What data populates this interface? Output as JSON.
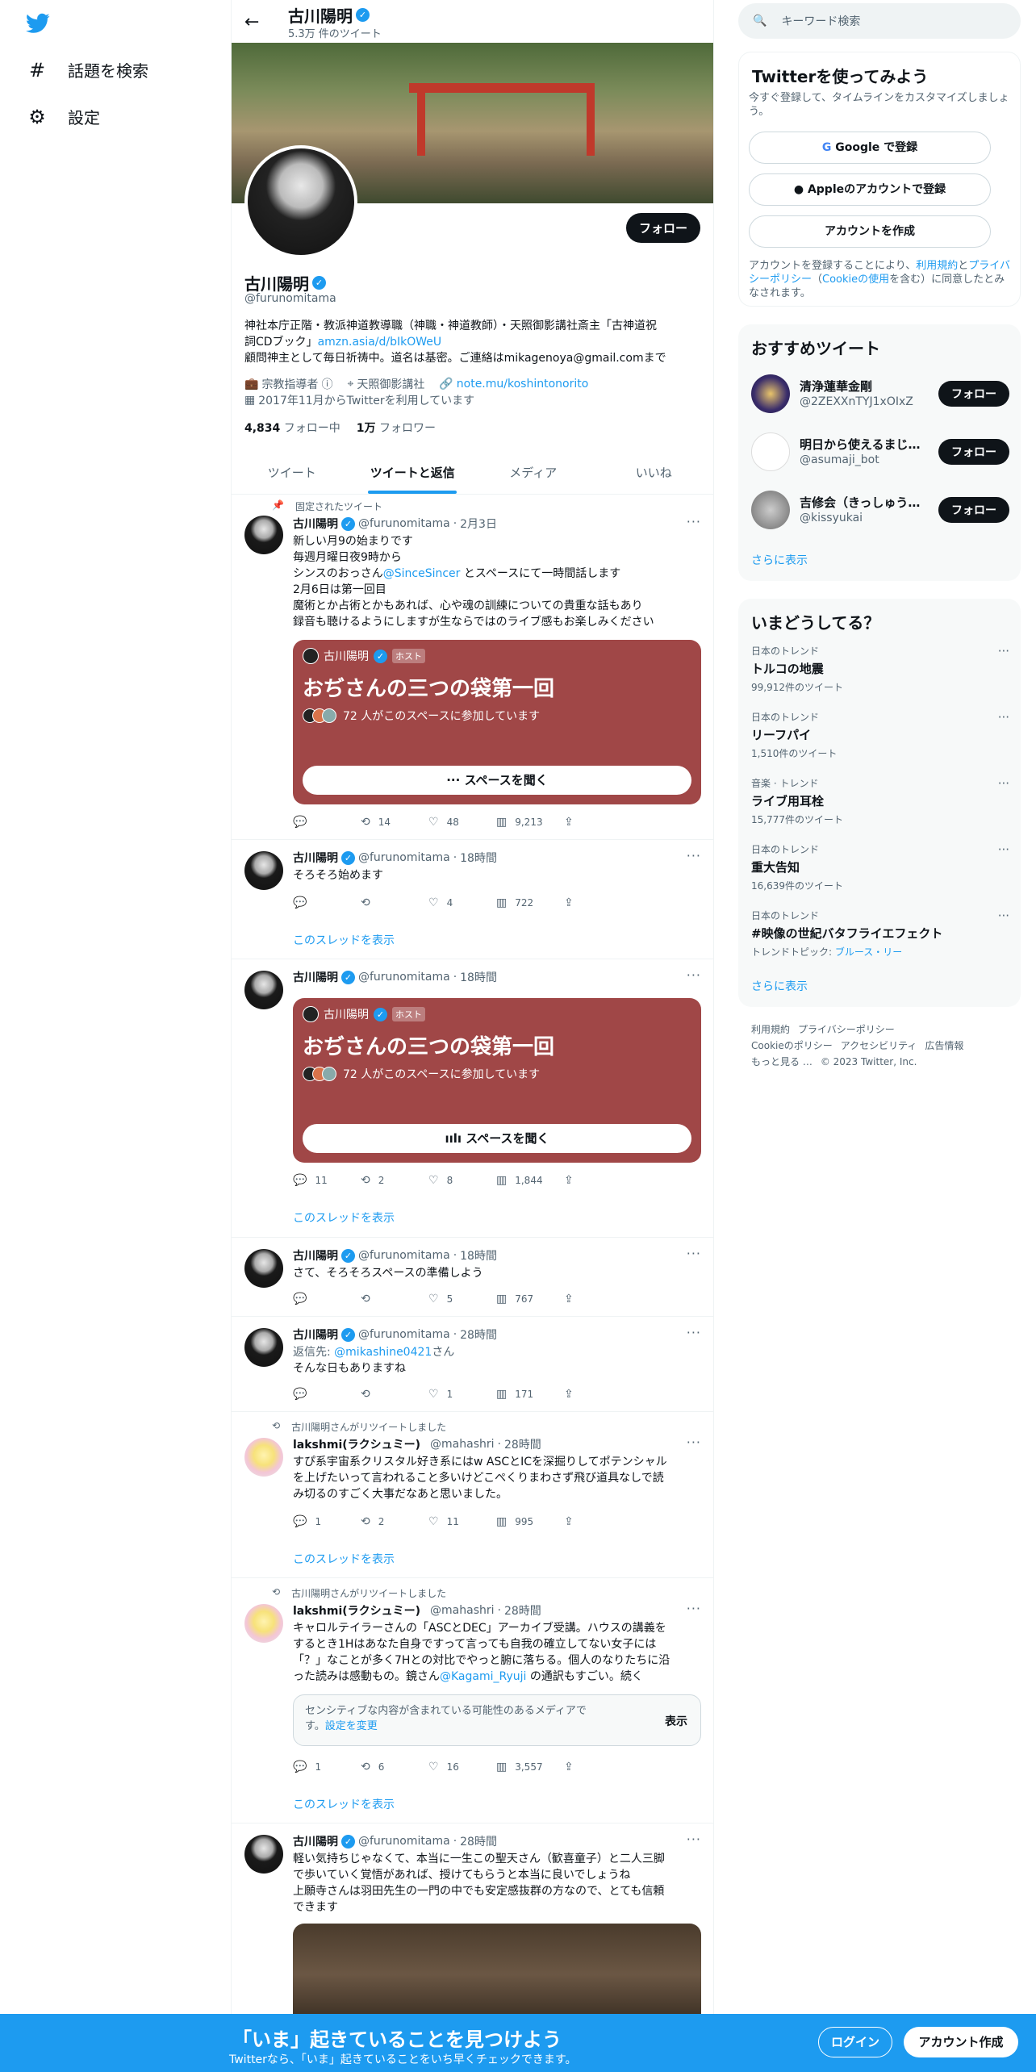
{
  "nav": {
    "explore": "話題を検索",
    "settings": "設定"
  },
  "header": {
    "name": "古川陽明",
    "count": "5.3万 件のツイート"
  },
  "profile": {
    "follow": "フォロー",
    "name": "古川陽明",
    "handle": "@furunomitama",
    "bio1": "神社本庁正階・教派神道教導職（神職・神道教師）・天照御影講社斎主「古神道祝",
    "bio2a": "詞CDブック」",
    "bio2link": "amzn.asia/d/bIkOWeU",
    "bio3": "顧問神主として毎日祈祷中。道名は基密。ご連絡はmikagenoya@gmail.comまで",
    "category": "宗教指導者",
    "location": "天照御影講社",
    "url": "note.mu/koshintonorito",
    "joined": "2017年11月からTwitterを利用しています",
    "following_n": "4,834",
    "following_l": "フォロー中",
    "followers_n": "1万",
    "followers_l": "フォロワー"
  },
  "tabs": [
    "ツイート",
    "ツイートと返信",
    "メディア",
    "いいね"
  ],
  "tweets": {
    "pinned": "固定されたツイート",
    "t1": {
      "name": "古川陽明",
      "handle": "@furunomitama",
      "time": "2月3日",
      "l1": "新しい月9の始まりです",
      "l2": "毎週月曜日夜9時から",
      "l3a": "シンスのおっさん",
      "l3b": "@SinceSincer",
      "l3c": " とスペースにて一時間話します",
      "l4": "2月6日は第一回目",
      "l5": "魔術とか占術とかもあれば、心や魂の訓練についての貴重な話もあり",
      "l6": "録音も聴けるようにしますが生ならではのライブ感もお楽しみください",
      "reply": "",
      "rt": "14",
      "like": "48",
      "views": "9,213"
    },
    "space": {
      "host": "古川陽明",
      "tag": "ホスト",
      "title": "おぢさんの三つの袋第一回",
      "part": "72 人がこのスペースに参加しています",
      "listen": "スペースを聞く"
    },
    "t2": {
      "name": "古川陽明",
      "handle": "@furunomitama",
      "time": "18時間",
      "text": "そろそろ始めます",
      "like": "4",
      "views": "722"
    },
    "thread": "このスレッドを表示",
    "t3": {
      "name": "古川陽明",
      "handle": "@furunomitama",
      "time": "18時間",
      "reply": "11",
      "rt": "2",
      "like": "8",
      "views": "1,844"
    },
    "t4": {
      "name": "古川陽明",
      "handle": "@furunomitama",
      "time": "18時間",
      "text": "さて、そろそろスペースの準備しよう",
      "like": "5",
      "views": "767"
    },
    "t5": {
      "name": "古川陽明",
      "handle": "@furunomitama",
      "time": "28時間",
      "replyto": "返信先: ",
      "replyhandle": "@mikashine0421",
      "replysuffix": "さん",
      "text": "そんな日もありますね",
      "like": "1",
      "views": "171"
    },
    "rtlabel": "古川陽明さんがリツイートしました",
    "t6": {
      "name": "lakshmi(ラクシュミー)",
      "handle": "@mahashri",
      "time": "28時間",
      "l1": "すぴ系宇宙系クリスタル好き系にはw ASCとICを深掘りしてポテンシャル",
      "l2": "を上げたいって言われること多いけどこぺくりまわさず飛び道具なしで読",
      "l3": "み切るのすごく大事だなあと思いました。",
      "reply": "1",
      "rt": "2",
      "like": "11",
      "views": "995"
    },
    "t7": {
      "name": "lakshmi(ラクシュミー)",
      "handle": "@mahashri",
      "time": "28時間",
      "l1": "キャロルテイラーさんの「ASCとDEC」アーカイブ受講。ハウスの講義を",
      "l2": "するとき1Hはあなた自身ですって言っても自我の確立してない女子には",
      "l3": "「？」なことが多く7Hとの対比でやっと腑に落ちる。個人のなりたちに沿",
      "l4a": "った読みは感動もの。鏡さん",
      "l4b": "@Kagami_Ryuji",
      "l4c": " の通訳もすごい。続く",
      "sens1": "センシティブな内容が含まれている可能性のあるメディアで",
      "sens2a": "す。",
      "sens2b": "設定を変更",
      "show": "表示",
      "reply": "1",
      "rt": "6",
      "like": "16",
      "views": "3,557"
    },
    "t8": {
      "name": "古川陽明",
      "handle": "@furunomitama",
      "time": "28時間",
      "l1": "軽い気持ちじゃなくて、本当に一生この聖天さん（歓喜童子）と二人三脚",
      "l2": "で歩いていく覚悟があれば、授けてもらうと本当に良いでしょうね",
      "l3": "上願寺さんは羽田先生の一門の中でも安定感抜群の方なので、とても信頼",
      "l4": "できます"
    }
  },
  "right": {
    "search": "キーワード検索",
    "join": {
      "title": "Twitterを使ってみよう",
      "sub": "今すぐ登録して、タイムラインをカスタマイズしましょう。",
      "google": "Google で登録",
      "apple": "Appleのアカウントで登録",
      "create": "アカウントを作成",
      "legal1": "アカウントを登録することにより、",
      "terms": "利用規約",
      "legal2": "と",
      "privacy": "プライバシーポリシー",
      "legal3": "（",
      "cookie": "Cookieの使用",
      "legal4": "を含む）に同意したとみなされます。"
    },
    "rec": {
      "title": "おすすめツイート",
      "follow": "フォロー",
      "more": "さらに表示",
      "u": [
        {
          "name": "清浄蓮華金剛",
          "handle": "@2ZEXXnTYJ1xOIxZ"
        },
        {
          "name": "明日から使えるまじ…",
          "handle": "@asumaji_bot"
        },
        {
          "name": "吉修会（きっしゅう…",
          "handle": "@kissyukai"
        }
      ]
    },
    "trends": {
      "title": "いまどうしてる？",
      "more": "さらに表示",
      "t": [
        {
          "c": "日本のトレンド",
          "n": "トルコの地震",
          "k": "99,912件のツイート"
        },
        {
          "c": "日本のトレンド",
          "n": "リーフパイ",
          "k": "1,510件のツイート"
        },
        {
          "c": "音楽 · トレンド",
          "n": "ライブ用耳栓",
          "k": "15,777件のツイート"
        },
        {
          "c": "日本のトレンド",
          "n": "重大告知",
          "k": "16,639件のツイート"
        },
        {
          "c": "日本のトレンド",
          "n": "#映像の世紀バタフライエフェクト",
          "k": "トレンドトピック: ",
          "k2": "ブルース・リー"
        }
      ]
    },
    "footer": {
      "a": "利用規約",
      "b": "プライバシーポリシー",
      "c": "Cookieのポリシー",
      "d": "アクセシビリティ",
      "e": "広告情報",
      "f": "もっと見る …",
      "g": "© 2023 Twitter, Inc."
    }
  },
  "bottom": {
    "h1": "「いま」起きていることを見つけよう",
    "h2": "Twitterなら、「いま」起きていることをいち早くチェックできます。",
    "login": "ログイン",
    "signup": "アカウント作成"
  }
}
